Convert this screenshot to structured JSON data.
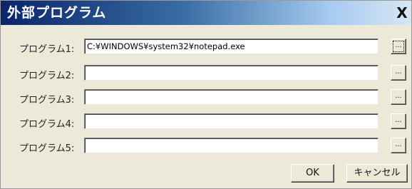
{
  "window": {
    "title": "外部プログラム",
    "close_glyph": "X"
  },
  "programs": [
    {
      "label": "プログラム1:",
      "value": "C:¥WINDOWS¥system32¥notepad.exe",
      "browse_label": "..."
    },
    {
      "label": "プログラム2:",
      "value": "",
      "browse_label": "..."
    },
    {
      "label": "プログラム3:",
      "value": "",
      "browse_label": "..."
    },
    {
      "label": "プログラム4:",
      "value": "",
      "browse_label": "..."
    },
    {
      "label": "プログラム5:",
      "value": "",
      "browse_label": "..."
    }
  ],
  "buttons": {
    "ok": "OK",
    "cancel": "キャンセル"
  }
}
